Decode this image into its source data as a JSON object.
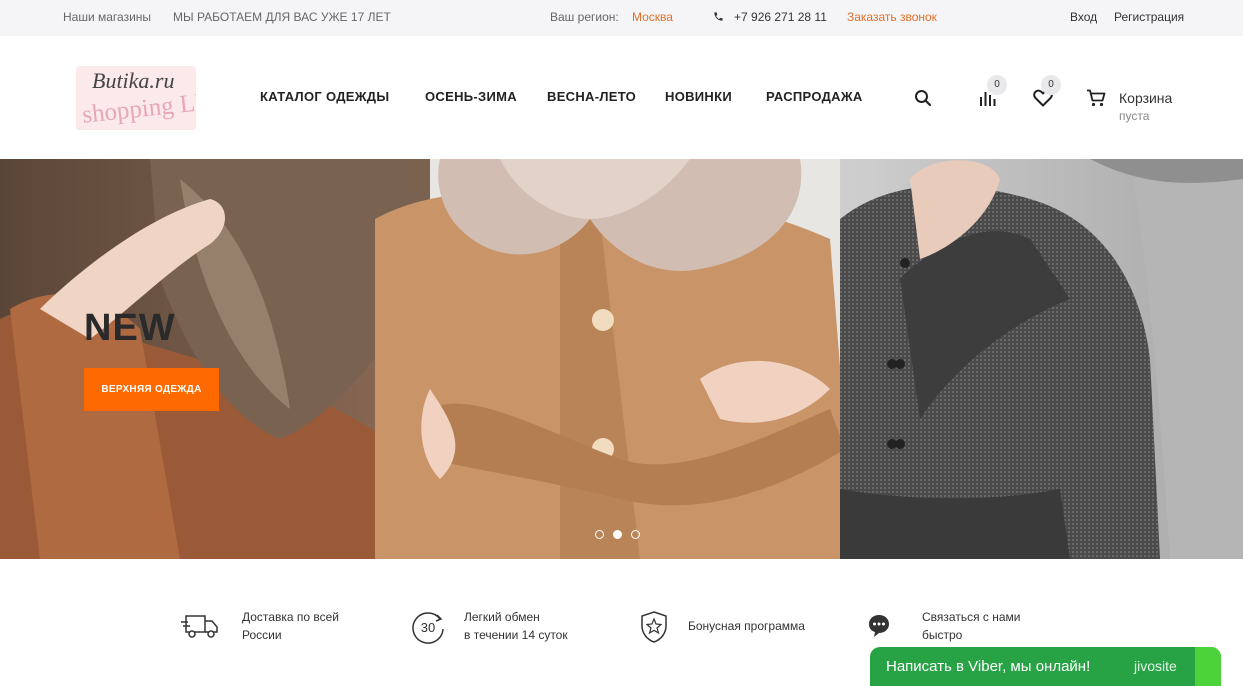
{
  "topbar": {
    "stores": "Наши магазины",
    "slogan": "МЫ РАБОТАЕМ ДЛЯ ВАС УЖЕ 17 ЛЕТ",
    "region_label": "Ваш регион:",
    "region_value": "Москва",
    "phone": "+7 926 271 28 11",
    "callback": "Заказать звонок",
    "login": "Вход",
    "register": "Регистрация"
  },
  "logo": {
    "line1": "Butika.ru",
    "line2": "shopping LUX"
  },
  "nav": [
    "КАТАЛОГ ОДЕЖДЫ",
    "ОСЕНЬ-ЗИМА",
    "ВЕСНА-ЛЕТО",
    "НОВИНКИ",
    "РАСПРОДАЖА"
  ],
  "header": {
    "compare_count": "0",
    "favorites_count": "0",
    "cart_title": "Корзина",
    "cart_status": "пуста"
  },
  "hero": {
    "title": "NEW",
    "button": "ВЕРХНЯЯ ОДЕЖДА",
    "slides_total": 3,
    "active_slide": 2
  },
  "features": [
    {
      "icon": "truck-icon",
      "line1": "Доставка по всей",
      "line2": "России"
    },
    {
      "icon": "exchange-30-icon",
      "badge": "30",
      "line1": "Легкий обмен",
      "line2": "в течении 14 суток"
    },
    {
      "icon": "star-shield-icon",
      "line1": "Бонусная программа",
      "line2": ""
    },
    {
      "icon": "chat-bubble-icon",
      "line1": "Связаться с нами",
      "line2": "быстро"
    }
  ],
  "chat": {
    "message": "Написать в Viber, мы онлайн!",
    "brand": "jivosite"
  },
  "colors": {
    "accent": "#ff6a00",
    "link_accent": "#e0702a",
    "chat_green": "#27a345"
  }
}
